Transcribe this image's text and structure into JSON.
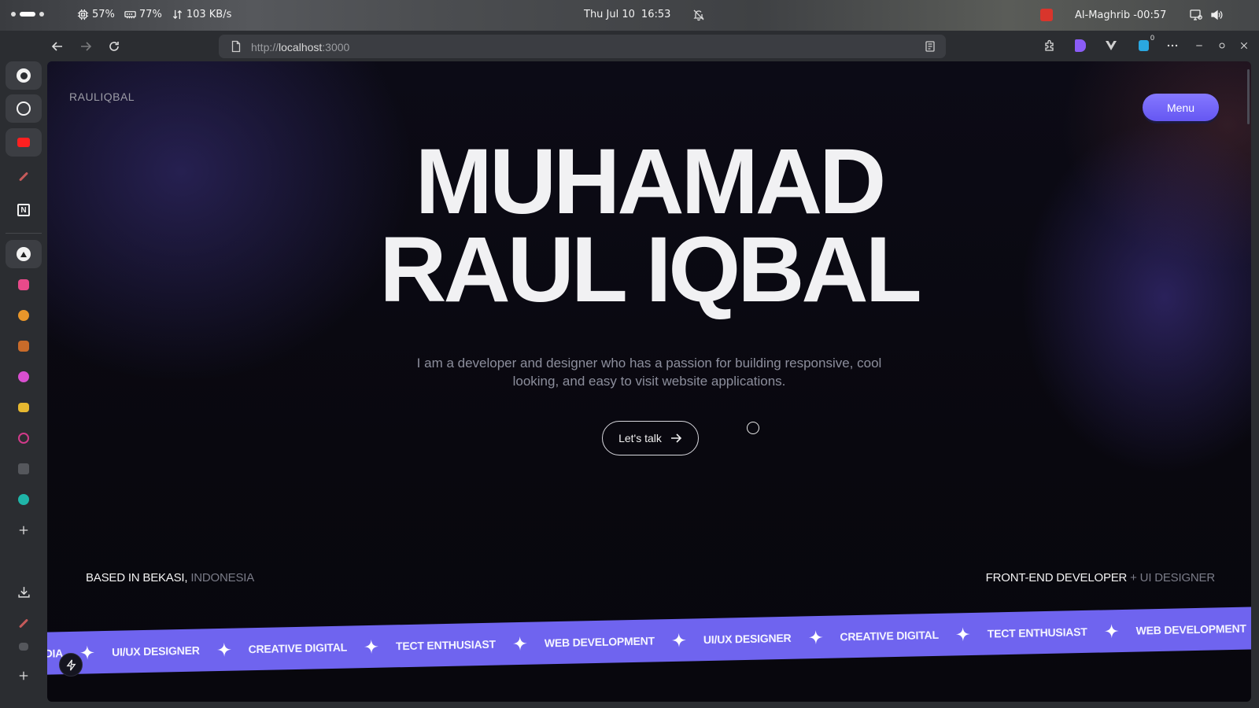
{
  "os": {
    "cpu": "57%",
    "memory": "77%",
    "network": "103 KB/s",
    "date": "Thu Jul 10",
    "time": "16:53",
    "prayer": "Al-Maghrib -00:57"
  },
  "browser": {
    "url_scheme": "http://",
    "url_host": "localhost",
    "url_port": ":3000",
    "ext_badge_count": "0"
  },
  "page": {
    "brand": "RAULIQBAL",
    "menu_label": "Menu",
    "hero_line1": "MUHAMAD",
    "hero_line2": "RAUL IQBAL",
    "description": "I am a developer and designer who has a passion for building responsive, cool looking, and easy to visit website applications.",
    "cta_label": "Let's talk",
    "based_main": "BASED IN BEKASI,",
    "based_muted": " INDONESIA",
    "role_main": "FRONT-END DEVELOPER",
    "role_muted": " + UI DESIGNER",
    "marquee": {
      "lead": "MEDIA",
      "items": [
        "UI/UX DESIGNER",
        "CREATIVE DIGITAL",
        "TECT ENTHUSIAST",
        "WEB DEVELOPMENT",
        "UI/UX DESIGNER",
        "CREATIVE DIGITAL",
        "TECT ENTHUSIAST",
        "WEB DEVELOPMENT"
      ]
    }
  },
  "colors": {
    "accent": "#6f64ef",
    "menu_button": "#7566f7",
    "background": "#0b0a12"
  },
  "icons": {
    "sidebar": [
      "github-icon",
      "openai-icon",
      "youtube-icon",
      "pen-icon",
      "notion-icon",
      "app-icon",
      "app-icon",
      "app-icon",
      "app-icon",
      "app-icon",
      "app-icon",
      "app-icon",
      "app-icon",
      "app-icon",
      "add-icon",
      "download-icon",
      "pen-icon",
      "app-icon",
      "add-icon"
    ]
  }
}
